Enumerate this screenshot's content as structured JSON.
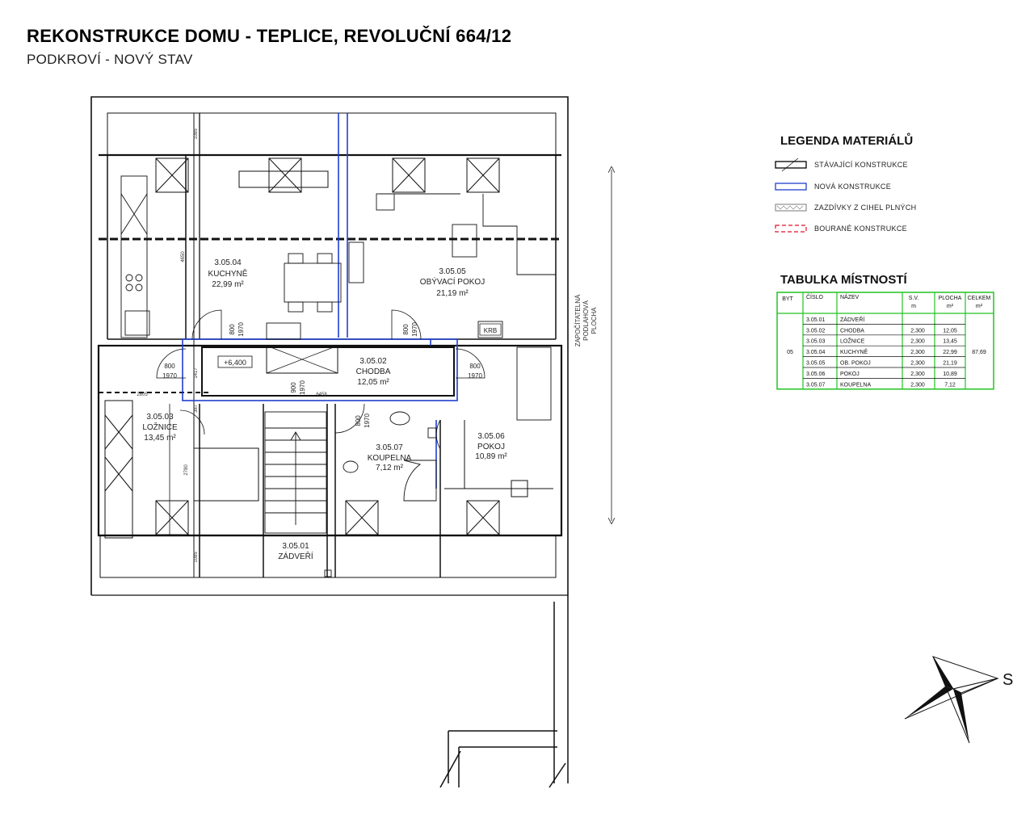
{
  "header": {
    "title": "REKONSTRUKCE DOMU - TEPLICE, REVOLUČNÍ 664/12",
    "subtitle": "PODKROVÍ - NOVÝ STAV"
  },
  "rooms": [
    {
      "id": "3.05.04",
      "name": "KUCHYNĚ",
      "area": "22,99 m²"
    },
    {
      "id": "3.05.05",
      "name": "OBÝVACÍ POKOJ",
      "area": "21,19 m²"
    },
    {
      "id": "3.05.02",
      "name": "CHODBA",
      "area": "12,05 m²"
    },
    {
      "id": "3.05.03",
      "name": "LOŽNICE",
      "area": "13,45 m²"
    },
    {
      "id": "3.05.07",
      "name": "KOUPELNA",
      "area": "7,12 m²"
    },
    {
      "id": "3.05.06",
      "name": "POKOJ",
      "area": "10,89 m²"
    },
    {
      "id": "3.05.01",
      "name": "ZÁDVEŘÍ",
      "area": ""
    }
  ],
  "doors": [
    {
      "w": "800",
      "h": "1970"
    },
    {
      "w": "800",
      "h": "1970"
    },
    {
      "w": "800",
      "h": "1970"
    },
    {
      "w": "800",
      "h": "1970"
    },
    {
      "w": "900",
      "h": "1970"
    },
    {
      "w": "800",
      "h": "1970"
    }
  ],
  "labels": {
    "level": "+6,400",
    "krb": "KRB",
    "side_note_1": "ZAPOČÍTATELNÁ",
    "side_note_2": "PODLAHOVÁ",
    "side_note_3": "PLOCHA",
    "north": "S"
  },
  "dims": {
    "d1085a": "1085",
    "d1085b": "1085",
    "d4650": "4650",
    "d1417": "1417",
    "d2805": "2805",
    "d2780": "2780",
    "d387": "387",
    "d6458": "6458"
  },
  "legend": {
    "title": "LEGENDA MATERIÁLŮ",
    "items": [
      {
        "label": "STÁVAJÍCÍ KONSTRUKCE",
        "color": "#000000"
      },
      {
        "label": "NOVÁ KONSTRUKCE",
        "color": "#1f3fd0"
      },
      {
        "label": "ZAZDÍVKY Z CIHEL PLNÝCH",
        "color": "#777777"
      },
      {
        "label": "BOURANÉ KONSTRUKCE",
        "color": "#e0102a"
      }
    ]
  },
  "room_table": {
    "title": "TABULKA MÍSTNOSTÍ",
    "headers": [
      "BYT",
      "ČÍSLO",
      "NÁZEV",
      "S.V. m",
      "PLOCHA m²",
      "CELKEM m²"
    ],
    "byt": "05",
    "total": "87,69",
    "rows": [
      {
        "cislo": "3.05.01",
        "nazev": "ZÁDVEŘÍ",
        "sv": "",
        "plocha": ""
      },
      {
        "cislo": "3.05.02",
        "nazev": "CHODBA",
        "sv": "2,300",
        "plocha": "12,05"
      },
      {
        "cislo": "3.05.03",
        "nazev": "LOŽNICE",
        "sv": "2,300",
        "plocha": "13,45"
      },
      {
        "cislo": "3.05.04",
        "nazev": "KUCHYNĚ",
        "sv": "2,300",
        "plocha": "22,99"
      },
      {
        "cislo": "3.05.05",
        "nazev": "OB. POKOJ",
        "sv": "2,300",
        "plocha": "21,19"
      },
      {
        "cislo": "3.05.06",
        "nazev": "POKOJ",
        "sv": "2,300",
        "plocha": "10,89"
      },
      {
        "cislo": "3.05.07",
        "nazev": "KOUPELNA",
        "sv": "2,300",
        "plocha": "7,12"
      }
    ],
    "border_color": "#22c322"
  }
}
